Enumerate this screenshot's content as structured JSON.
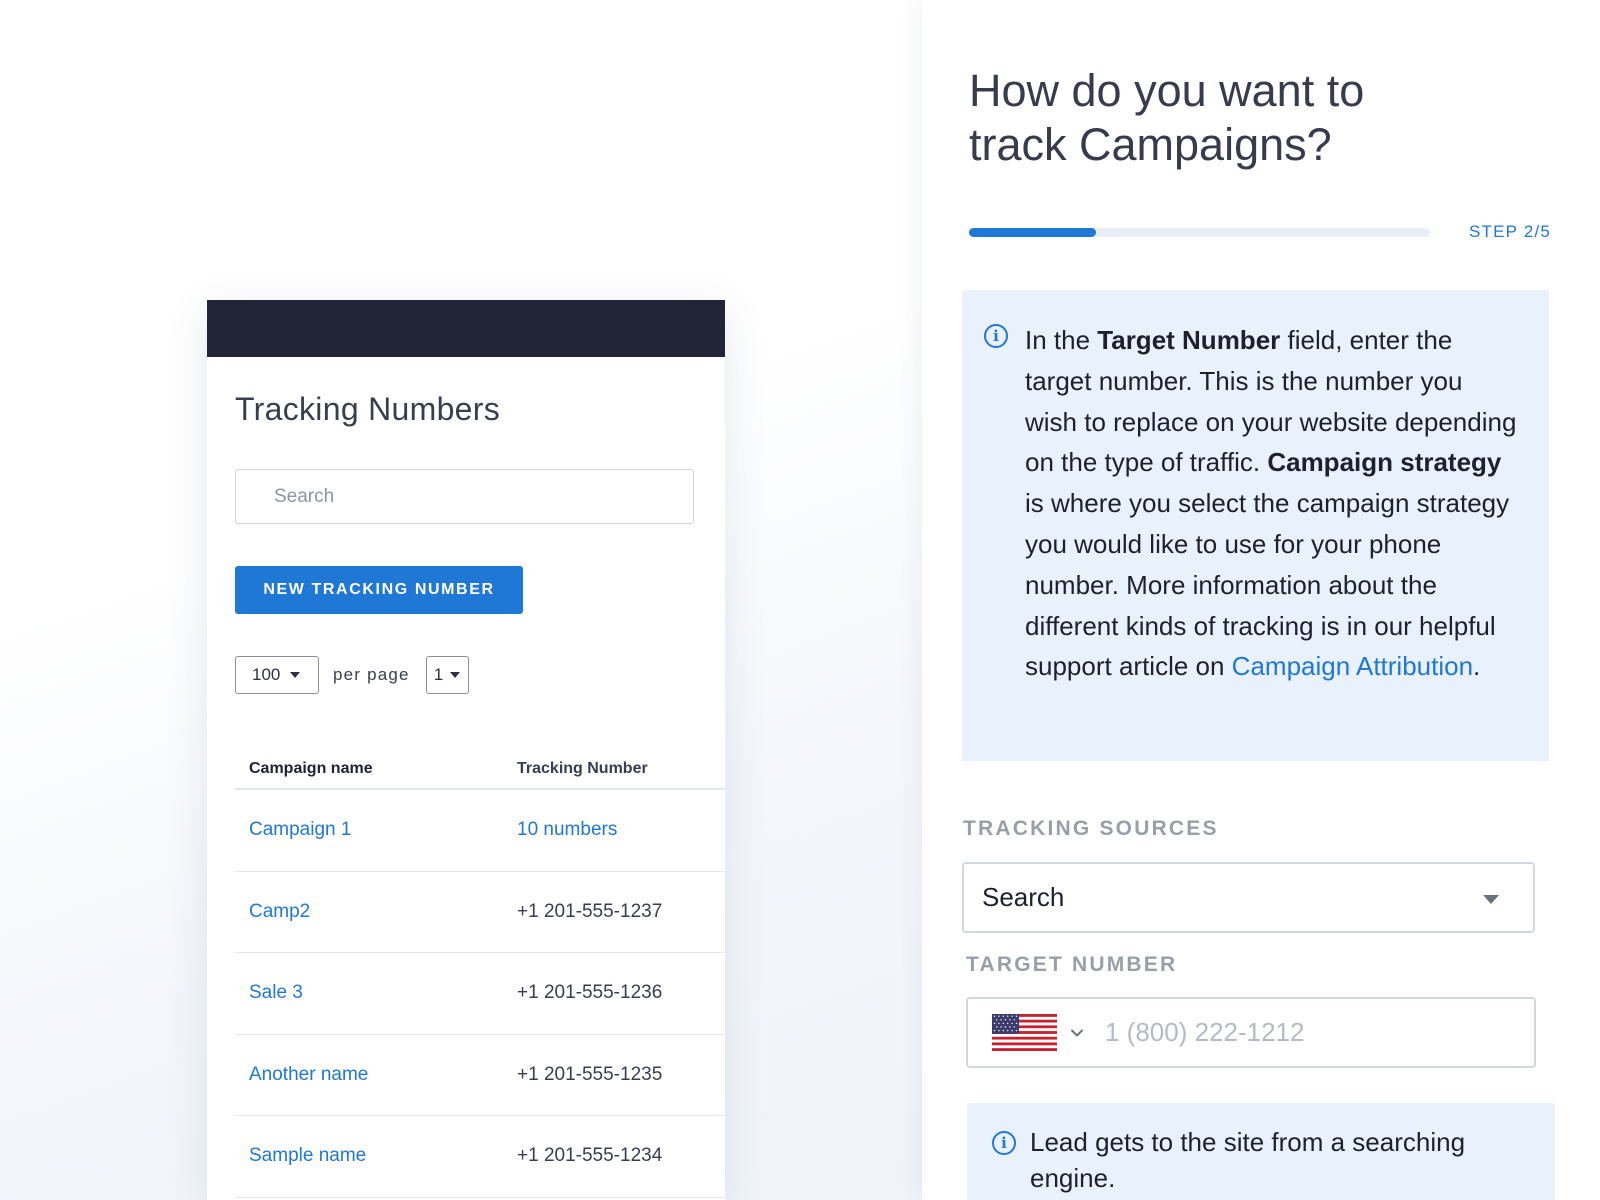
{
  "tracking_numbers": {
    "title": "Tracking Numbers",
    "search_placeholder": "Search",
    "new_button_label": "NEW TRACKING NUMBER",
    "pagination": {
      "per_page_value": "100",
      "per_page_label": "per page",
      "page_value": "1"
    },
    "table": {
      "columns": [
        "Campaign name",
        "Tracking Number"
      ],
      "rows": [
        {
          "campaign": "Campaign 1",
          "tracking": "10 numbers"
        },
        {
          "campaign": "Camp2",
          "tracking": "+1 201-555-1237"
        },
        {
          "campaign": "Sale 3",
          "tracking": "+1 201-555-1236"
        },
        {
          "campaign": "Another name",
          "tracking": "+1 201-555-1235"
        },
        {
          "campaign": "Sample name",
          "tracking": "+1 201-555-1234"
        }
      ]
    }
  },
  "wizard": {
    "title": "How do you want to track Campaigns?",
    "step_label": "STEP 2/5",
    "progress": 0.275,
    "info": {
      "p1": "In the ",
      "b1": "Target Number",
      "p2": " field, enter the target number. This is the number you wish to replace on your website depending on the type of traffic. ",
      "b2": "Campaign strategy",
      "p3": " is where you select the campaign strategy you would like to use for your phone number. More information about the different kinds of tracking is in our helpful support article on ",
      "link": "Campaign Attribution",
      "p4": "."
    },
    "tracking_sources_label": "TRACKING SOURCES",
    "tracking_source_value": "Search",
    "target_number_label": "TARGET NUMBER",
    "phone_placeholder": "1 (800) 222-1212",
    "country_flag": "us-flag-icon",
    "hint": "Lead gets to the site from a searching engine."
  },
  "colors": {
    "accent": "#1f77d6",
    "topbar": "#222538",
    "info_bg": "#e8f1fc"
  }
}
